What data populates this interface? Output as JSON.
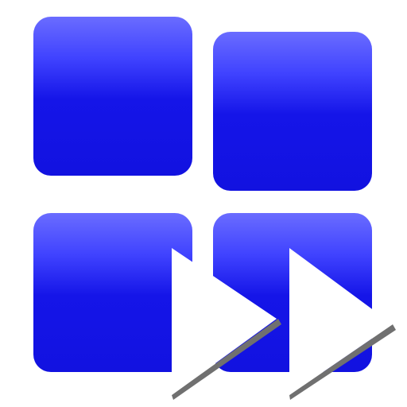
{
  "icon": {
    "semantic": "grid-fast-forward-icon",
    "tiles": [
      "tile-top-left",
      "tile-top-right",
      "tile-bottom-left",
      "tile-bottom-right"
    ],
    "arrows": [
      "fast-forward-arrow-1",
      "fast-forward-arrow-2"
    ],
    "colors": {
      "tile_light": "#6a6cff",
      "tile_dark": "#1212e0",
      "arrow_fill": "#ffffff",
      "arrow_shadow": "#707070",
      "background": "#ffffff"
    }
  }
}
